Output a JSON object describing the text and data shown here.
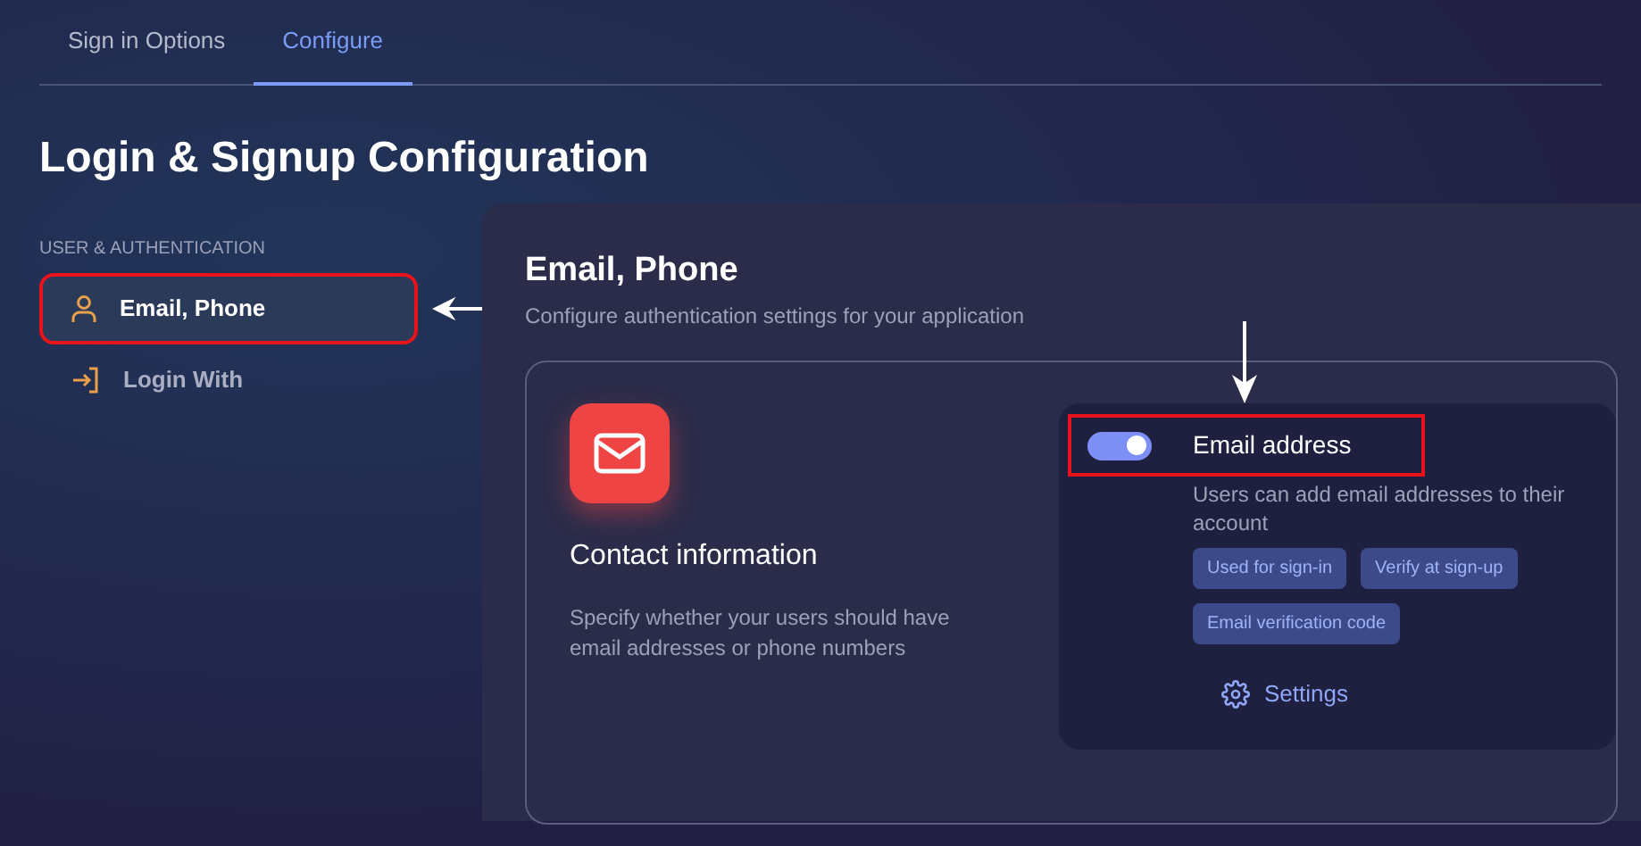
{
  "tabs": [
    {
      "label": "Sign in Options",
      "selected": false
    },
    {
      "label": "Configure",
      "selected": true
    }
  ],
  "title": "Login & Signup Configuration",
  "sidebar": {
    "section": "USER & AUTHENTICATION",
    "items": [
      {
        "label": "Email, Phone",
        "kind": "person",
        "selected": true
      },
      {
        "label": "Login With",
        "kind": "login",
        "selected": false
      }
    ]
  },
  "panel": {
    "title": "Email, Phone",
    "subtitle": "Configure authentication settings for your application",
    "contact": {
      "title": "Contact information",
      "description": "Specify whether your users should have email addresses or phone numbers"
    },
    "option": {
      "label": "Email address",
      "on": true,
      "description": "Users can add email addresses to their account",
      "tags": [
        "Used for sign-in",
        "Verify at sign-up",
        "Email verification code"
      ],
      "settings": "Settings"
    }
  }
}
